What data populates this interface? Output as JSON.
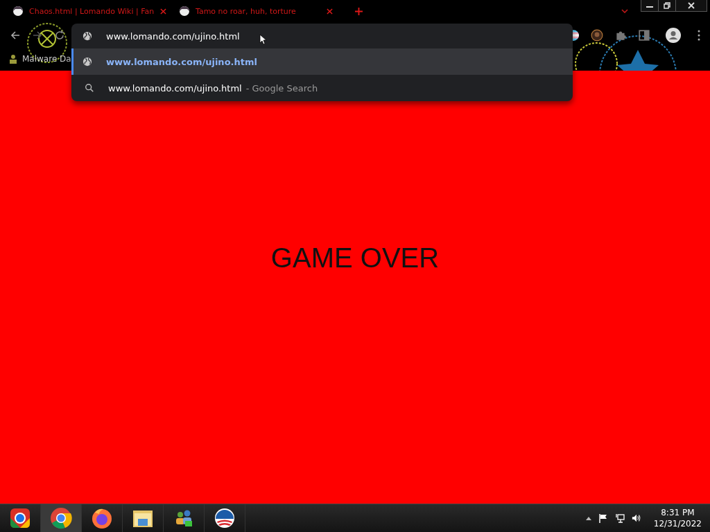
{
  "tabs": [
    {
      "title": "Chaos.html | Lomando Wiki | Fan"
    },
    {
      "title": "Tamo no roar, huh, torture"
    }
  ],
  "omnibox": {
    "value": "www.lomando.com/ujino.html"
  },
  "suggestions": [
    {
      "kind": "url",
      "text": "www.lomando.com/ujino.html",
      "selected": true
    },
    {
      "kind": "search",
      "text": "www.lomando.com/ujino.html",
      "suffix": "- Google Search",
      "selected": false
    }
  ],
  "bookmarks": [
    {
      "label": "Malware Da"
    }
  ],
  "page": {
    "heading": "GAME OVER"
  },
  "taskbar": {
    "time": "8:31 PM",
    "date": "12/31/2022"
  }
}
